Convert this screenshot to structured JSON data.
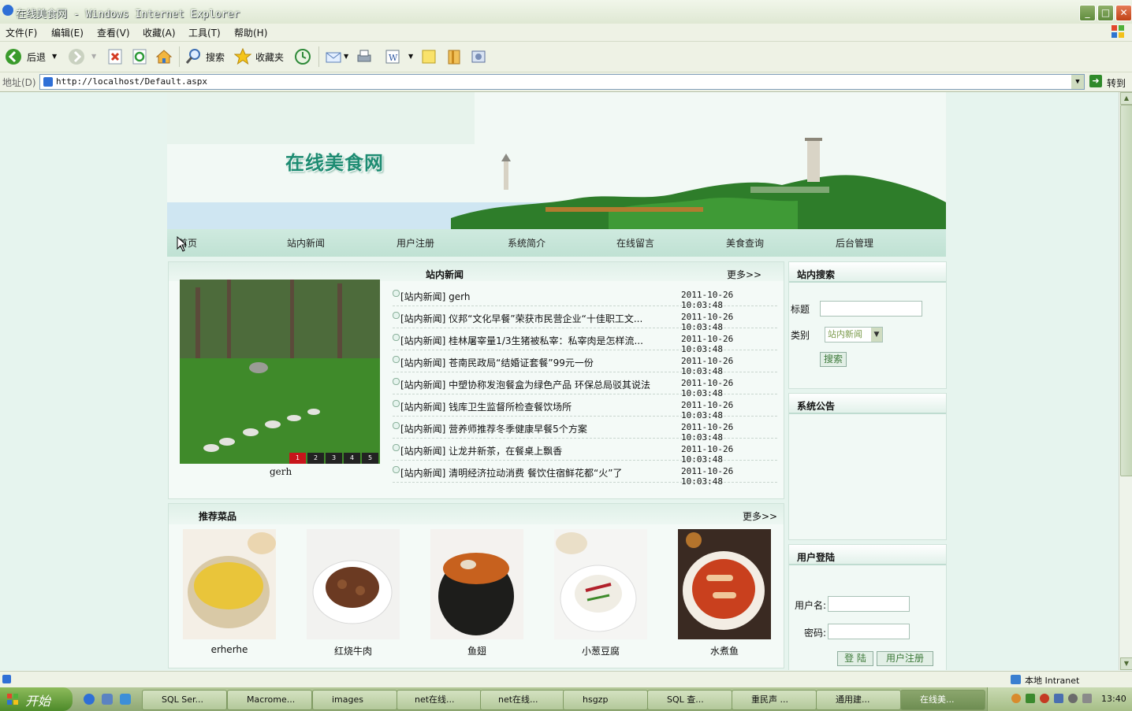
{
  "window": {
    "title": "在线美食网 - Windows Internet Explorer",
    "minimize": "_",
    "maximize": "□",
    "close": "✕"
  },
  "menu": [
    "文件(F)",
    "编辑(E)",
    "查看(V)",
    "收藏(A)",
    "工具(T)",
    "帮助(H)"
  ],
  "toolbar": {
    "back": "后退",
    "search": "搜索",
    "favorites": "收藏夹"
  },
  "address": {
    "label": "地址(D)",
    "url": "http://localhost/Default.aspx",
    "go": "转到"
  },
  "site": {
    "title": "在线美食网",
    "nav": [
      "首页",
      "站内新闻",
      "用户注册",
      "系统简介",
      "在线留言",
      "美食查询",
      "后台管理"
    ]
  },
  "news": {
    "header": "站内新闻",
    "more": "更多>>",
    "slide_caption": "gerh",
    "slide_numbers": [
      "1",
      "2",
      "3",
      "4",
      "5"
    ],
    "items": [
      {
        "title": "[站内新闻] gerh",
        "date": "2011-10-26 10:03:48"
      },
      {
        "title": "[站内新闻] 仪邦“文化早餐”荣获市民营企业“十佳职工文...",
        "date": "2011-10-26 10:03:48"
      },
      {
        "title": "[站内新闻] 桂林屠宰量1/3生猪被私宰：私宰肉是怎样流...",
        "date": "2011-10-26 10:03:48"
      },
      {
        "title": "[站内新闻] 苍南民政局“结婚证套餐”99元一份",
        "date": "2011-10-26 10:03:48"
      },
      {
        "title": "[站内新闻] 中塑协称发泡餐盒为绿色产品 环保总局驳其说法",
        "date": "2011-10-26 10:03:48"
      },
      {
        "title": "[站内新闻] 钱库卫生监督所检查餐饮场所",
        "date": "2011-10-26 10:03:48"
      },
      {
        "title": "[站内新闻] 营养师推荐冬季健康早餐5个方案",
        "date": "2011-10-26 10:03:48"
      },
      {
        "title": "[站内新闻] 让龙井新茶，在餐桌上飘香",
        "date": "2011-10-26 10:03:48"
      },
      {
        "title": "[站内新闻] 清明经济拉动消费 餐饮住宿鲜花都“火”了",
        "date": "2011-10-26 10:03:48"
      }
    ]
  },
  "dishes": {
    "header": "推荐菜品",
    "more": "更多>>",
    "items": [
      "erherhe",
      "红烧牛肉",
      "鱼翅",
      "小葱豆腐",
      "水煮鱼"
    ]
  },
  "search_panel": {
    "header": "站内搜索",
    "title_label": "标题",
    "category_label": "类别",
    "category_value": "站内新闻",
    "button": "搜索"
  },
  "notice_panel": {
    "header": "系统公告"
  },
  "login_panel": {
    "header": "用户登陆",
    "username_label": "用户名:",
    "password_label": "密码:",
    "login_button": "登 陆",
    "register_button": "用户注册"
  },
  "statusbar": {
    "zone": "本地 Intranet"
  },
  "taskbar": {
    "start": "开始",
    "tasks": [
      "SQL Ser...",
      "Macrome...",
      "images",
      "net在线...",
      "net在线...",
      "hsgzp",
      "SQL 查...",
      "重民声 ...",
      "通用建...",
      "在线美..."
    ],
    "clock": "13:40"
  },
  "colors": {
    "accent": "#1d8c72",
    "page_bg": "#e6f4ee",
    "active_slide": "#c8151b"
  }
}
